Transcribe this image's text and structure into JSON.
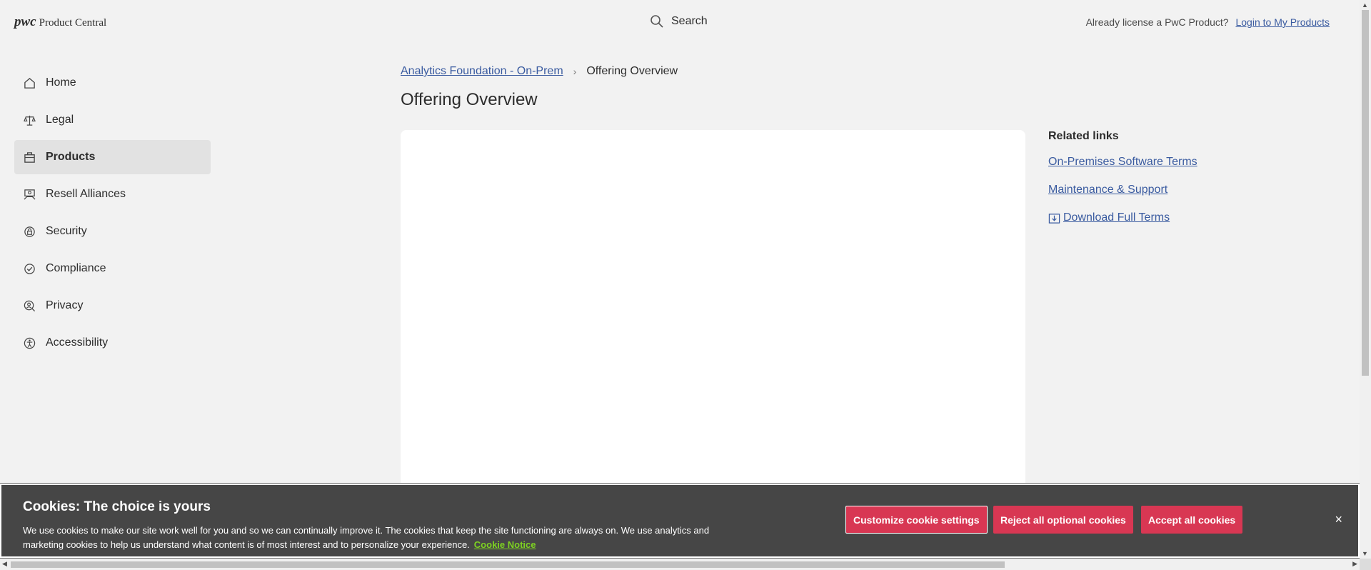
{
  "header": {
    "logo_mark": "pwc",
    "logo_text": "Product Central",
    "search_label": "Search",
    "license_text": "Already license a PwC Product?",
    "login_link": "Login to My Products"
  },
  "sidebar": {
    "items": [
      {
        "label": "Home",
        "icon": "home-icon"
      },
      {
        "label": "Legal",
        "icon": "scales-icon"
      },
      {
        "label": "Products",
        "icon": "briefcase-icon",
        "active": true
      },
      {
        "label": "Resell Alliances",
        "icon": "handshake-icon"
      },
      {
        "label": "Security",
        "icon": "lock-shield-icon"
      },
      {
        "label": "Compliance",
        "icon": "check-circle-icon"
      },
      {
        "label": "Privacy",
        "icon": "user-search-icon"
      },
      {
        "label": "Accessibility",
        "icon": "accessibility-icon"
      }
    ]
  },
  "breadcrumb": {
    "parent": "Analytics Foundation - On-Prem",
    "current": "Offering Overview"
  },
  "main": {
    "title": "Offering Overview"
  },
  "related": {
    "heading": "Related links",
    "links": [
      "On-Premises Software Terms",
      "Maintenance & Support"
    ],
    "download": "Download Full Terms"
  },
  "cookie": {
    "title": "Cookies: The choice is yours",
    "body": "We use cookies to make our site work well for you and so we can continually improve it. The cookies that keep the site functioning are always on. We use analytics and marketing cookies to help us understand what content is of most interest and to personalize your experience.",
    "notice_link": "Cookie Notice",
    "customize": "Customize cookie settings",
    "reject": "Reject all optional cookies",
    "accept": "Accept all cookies",
    "close": "×"
  },
  "colors": {
    "accent": "#d83753",
    "link": "#3a5ba0",
    "cookie_link": "#7ed321"
  }
}
